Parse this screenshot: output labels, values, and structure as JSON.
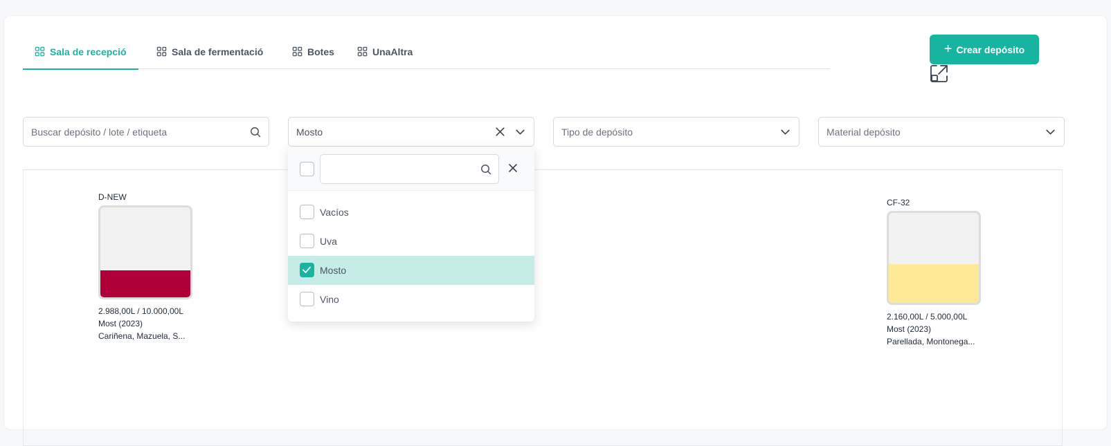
{
  "tabs": [
    {
      "label": "Sala de recepció",
      "active": true,
      "icon": "grid-icon"
    },
    {
      "label": "Sala de fermentació",
      "active": false,
      "icon": "grid-icon"
    },
    {
      "label": "Botes",
      "active": false,
      "icon": "grid-icon"
    },
    {
      "label": "UnaAltra",
      "active": false,
      "icon": "grid-icon"
    }
  ],
  "toolbar": {
    "create_label": "Crear depósito",
    "create_icon": "plus-icon",
    "expand_icon": "expand-icon"
  },
  "filters": {
    "search_placeholder": "Buscar depósito / lote / etiqueta",
    "estado_value": "Mosto",
    "tipo_placeholder": "Tipo de depósito",
    "material_placeholder": "Material depósito"
  },
  "dropdown": {
    "search_value": "",
    "options": [
      {
        "label": "Vacíos",
        "checked": false
      },
      {
        "label": "Uva",
        "checked": false
      },
      {
        "label": "Mosto",
        "checked": true
      },
      {
        "label": "Vino",
        "checked": false
      }
    ]
  },
  "tanks": [
    {
      "name": "D-NEW",
      "volume": "2.988,00L / 10.000,00L",
      "content": "Most (2023)",
      "varieties": "Cariñena, Mazuela, S...",
      "fill_fraction": 0.3,
      "fill_color": "#b0003a"
    },
    {
      "name": "CF-32",
      "volume": "2.160,00L / 5.000,00L",
      "content": "Most (2023)",
      "varieties": "Parellada, Montonega...",
      "fill_fraction": 0.43,
      "fill_color": "#ffe896"
    }
  ],
  "colors": {
    "accent": "#17b5a0",
    "selected_bg": "#c6ece7"
  }
}
